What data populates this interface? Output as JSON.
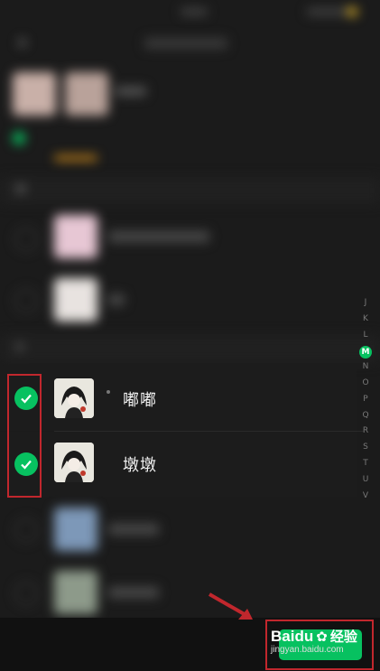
{
  "status_bar": {
    "time": "",
    "battery": ""
  },
  "header": {
    "title": "",
    "back_icon": "back-arrow-icon"
  },
  "contacts": [
    {
      "name": "嘟嘟",
      "checked": true
    },
    {
      "name": "墩墩",
      "checked": true
    }
  ],
  "index_letters": [
    "J",
    "K",
    "L",
    "M",
    "N",
    "O",
    "P",
    "Q",
    "R",
    "S",
    "T",
    "U",
    "V"
  ],
  "active_index": "M",
  "watermark": {
    "brand": "Baidu",
    "product": "经验",
    "url": "jingyan.baidu.com"
  },
  "colors": {
    "accent": "#07c160",
    "annotation": "#c1272d"
  }
}
